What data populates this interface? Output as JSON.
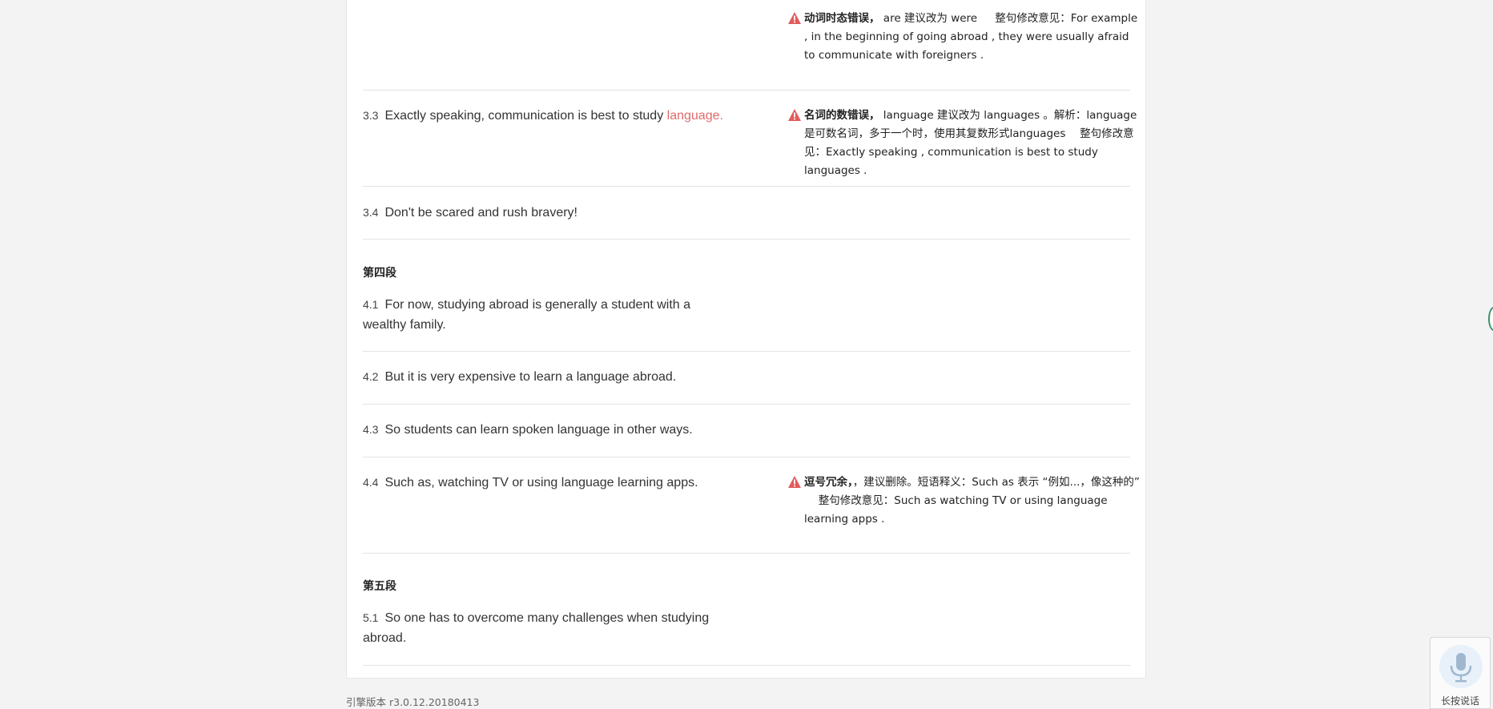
{
  "rows": [
    {
      "number": "",
      "sentence": "",
      "comment": {
        "type": "动词时态错误，",
        "text": " are 建议改为 were 　 整句修改意见：For example , in the beginning of going abroad , they were usually afraid to communicate with foreigners ."
      }
    },
    {
      "number": "3.3",
      "sentence_before": "Exactly speaking, communication is best to study ",
      "sentence_error": "language",
      "sentence_after": ".",
      "comment": {
        "type": "名词的数错误，",
        "text": " language 建议改为 languages 。解析：language是可数名词，多于一个时，使用其复数形式languages 　整句修改意见：Exactly speaking , communication is best to study languages ."
      }
    },
    {
      "number": "3.4",
      "sentence": "Don't be scared and rush bravery!"
    },
    {
      "paragraph_title": "第四段",
      "number": "4.1",
      "sentence": "For now, studying abroad is generally a student with a wealthy family."
    },
    {
      "number": "4.2",
      "sentence": "But it is very expensive to learn a language abroad."
    },
    {
      "number": "4.3",
      "sentence": "So students can learn spoken language in other ways."
    },
    {
      "number": "4.4",
      "sentence": "Such as, watching TV or using language learning apps.",
      "comment": {
        "type": "逗号冗余，",
        "text": "，建议删除。短语释义：Such as 表示 “例如...，像这种的” 　 整句修改意见：Such as watching TV or using language learning apps ."
      }
    },
    {
      "paragraph_title": "第五段",
      "number": "5.1",
      "sentence": "So one has to overcome many challenges when studying abroad."
    }
  ],
  "footer": {
    "version": "引擎版本 r3.0.12.20180413"
  },
  "voice": {
    "label": "长按说话"
  },
  "colors": {
    "error_highlight": "#e06a6a",
    "warning_icon": "#e35a5a",
    "divider": "#e3e3e3"
  },
  "icons": {
    "warning": "warning-icon",
    "microphone": "microphone-icon"
  }
}
